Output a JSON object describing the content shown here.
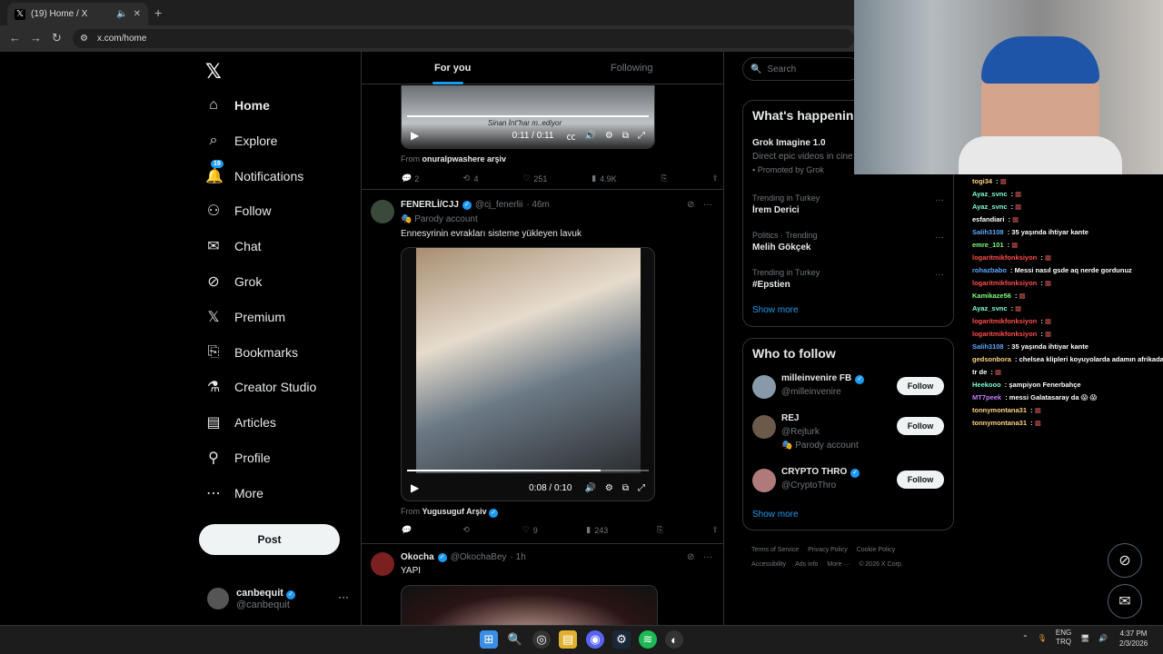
{
  "browser": {
    "tab_title": "(19) Home / X",
    "url": "x.com/home"
  },
  "sidebar": {
    "items": [
      {
        "label": "Home",
        "icon": "home-icon"
      },
      {
        "label": "Explore",
        "icon": "search-icon"
      },
      {
        "label": "Notifications",
        "icon": "bell-icon",
        "badge": "19"
      },
      {
        "label": "Follow",
        "icon": "person-add-icon"
      },
      {
        "label": "Chat",
        "icon": "mail-icon"
      },
      {
        "label": "Grok",
        "icon": "grok-icon"
      },
      {
        "label": "Premium",
        "icon": "x-icon"
      },
      {
        "label": "Bookmarks",
        "icon": "bookmark-icon"
      },
      {
        "label": "Creator Studio",
        "icon": "flask-icon"
      },
      {
        "label": "Articles",
        "icon": "article-icon"
      },
      {
        "label": "Profile",
        "icon": "person-icon"
      },
      {
        "label": "More",
        "icon": "more-circle-icon"
      }
    ],
    "post_label": "Post",
    "account": {
      "name": "canbequit",
      "handle": "@canbequit"
    }
  },
  "feed": {
    "tabs": [
      "For you",
      "Following"
    ],
    "tweet1": {
      "subtitle": "Sinan İnt\"har m..ediyor",
      "time": "0:11 / 0:11",
      "progress": 1.0,
      "from_label": "From",
      "from": "onuralpwashere arşiv",
      "replies": "2",
      "reposts": "4",
      "likes": "251",
      "views": "4.9K"
    },
    "tweet2": {
      "name": "FENERLİ/CJJ",
      "handle": "@cj_fenerlii",
      "age": "· 46m",
      "parody": "Parody account",
      "text": "Ennesyrinin evrakları sisteme yükleyen lavuk",
      "time": "0:08 / 0:10",
      "progress": 0.8,
      "from_label": "From",
      "from": "Yugusuguf Arşiv",
      "replies": "",
      "reposts": "",
      "likes": "9",
      "views": "243"
    },
    "tweet3": {
      "name": "Okocha",
      "handle": "@OkochaBey",
      "age": "· 1h",
      "text": "YAPI"
    }
  },
  "right": {
    "search_placeholder": "Search",
    "happening_title": "What's happenin",
    "promo": {
      "title": "Grok Imagine 1.0",
      "desc": "Direct epic videos in cine",
      "promoted": "Promoted by Grok"
    },
    "trends": [
      {
        "meta": "Trending in Turkey",
        "name": "İrem Derici"
      },
      {
        "meta": "Politics · Trending",
        "name": "Melih Gökçek"
      },
      {
        "meta": "Trending in Turkey",
        "name": "#Epstien"
      }
    ],
    "show_more": "Show more",
    "wtf_title": "Who to follow",
    "wtf": [
      {
        "name": "milleinvenire FB",
        "handle": "@milleinvenire",
        "verified": true,
        "parody": ""
      },
      {
        "name": "REJ",
        "handle": "@Rejturk",
        "verified": false,
        "parody": "Parody account"
      },
      {
        "name": "CRYPTO THRO",
        "handle": "@CryptoThro",
        "verified": true,
        "parody": ""
      }
    ],
    "follow_label": "Follow",
    "footer": [
      "Terms of Service",
      "Privacy Policy",
      "Cookie Policy",
      "Accessibility",
      "Ads info",
      "More ···",
      "© 2026 X Corp."
    ]
  },
  "chat": [
    {
      "user": "togi34",
      "color": "#ffd27f",
      "msg": ""
    },
    {
      "user": "Ayaz_svnc",
      "color": "#7fffd4",
      "msg": ""
    },
    {
      "user": "Ayaz_svnc",
      "color": "#7fffd4",
      "msg": ""
    },
    {
      "user": "esfandiari",
      "color": "#ffffff",
      "msg": ""
    },
    {
      "user": "Salih3108",
      "color": "#5fa8ff",
      "msg": "35 yaşında ihtiyar kante"
    },
    {
      "user": "emre_101",
      "color": "#7cff7c",
      "msg": ""
    },
    {
      "user": "logaritmikfonksiyon",
      "color": "#ff4d4d",
      "msg": ""
    },
    {
      "user": "rohazbabo",
      "color": "#5fa8ff",
      "msg": "Messi nasıl gsde aq nerde gordunuz"
    },
    {
      "user": "logaritmikfonksiyon",
      "color": "#ff4d4d",
      "msg": ""
    },
    {
      "user": "Kamikaze56",
      "color": "#7cff7c",
      "msg": ""
    },
    {
      "user": "Ayaz_svnc",
      "color": "#7fffd4",
      "msg": ""
    },
    {
      "user": "logaritmikfonksiyon",
      "color": "#ff4d4d",
      "msg": ""
    },
    {
      "user": "logaritmikfonksiyon",
      "color": "#ff4d4d",
      "msg": ""
    },
    {
      "user": "Salih3108",
      "color": "#5fa8ff",
      "msg": "35 yaşında ihtiyar kante"
    },
    {
      "user": "gedsonbora",
      "color": "#ffd27f",
      "msg": "chelsea klipleri koyuyolarda adamın afrikada öldü boku çıktı amk bi sik yapamaz"
    },
    {
      "user": "tr de",
      "color": "#ffffff",
      "msg": ""
    },
    {
      "user": "Heekooo",
      "color": "#7fffd4",
      "msg": "şampiyon Fenerbahçe"
    },
    {
      "user": "MT7peek",
      "color": "#c77dff",
      "msg": "messi Galatasaray da 😱 😱"
    },
    {
      "user": "tonnymontana31",
      "color": "#ffd27f",
      "msg": ""
    },
    {
      "user": "tonnymontana31",
      "color": "#ffd27f",
      "msg": ""
    }
  ],
  "tray": {
    "lang1": "ENG",
    "lang2": "TRQ",
    "time": "4:37 PM",
    "date": "2/3/2026"
  }
}
